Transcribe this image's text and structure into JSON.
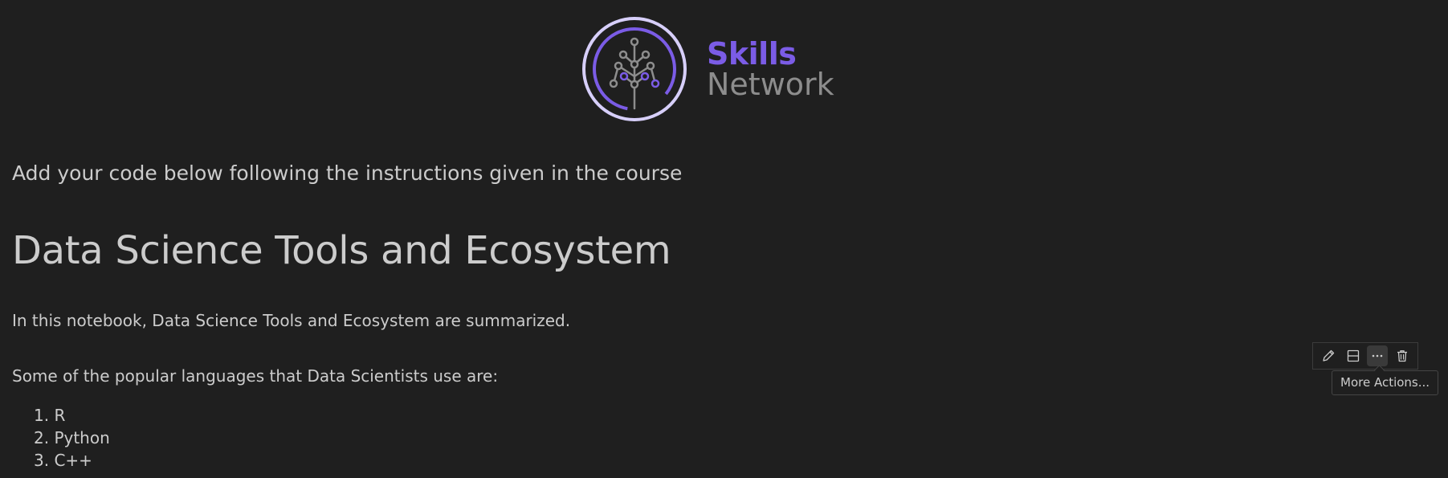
{
  "logo": {
    "line1": "Skills",
    "line2": "Network",
    "accent_color": "#7b5ce6",
    "icon": "skills-network-tree-icon"
  },
  "markdown": {
    "instruction": "Add your code below following the instructions given in the course",
    "title": "Data Science Tools and Ecosystem",
    "intro": "In this notebook, Data Science Tools and Ecosystem are summarized.",
    "languages_heading": "Some of the popular languages that Data Scientists use are:",
    "languages": [
      "1. R",
      "2. Python",
      "3. C++"
    ]
  },
  "cell_toolbar": {
    "buttons": [
      {
        "icon": "pencil-icon",
        "label": "Edit"
      },
      {
        "icon": "split-cell-icon",
        "label": "Split Cell"
      },
      {
        "icon": "ellipsis-icon",
        "label": "More Actions..."
      },
      {
        "icon": "trash-icon",
        "label": "Delete"
      }
    ],
    "tooltip": "More Actions..."
  }
}
